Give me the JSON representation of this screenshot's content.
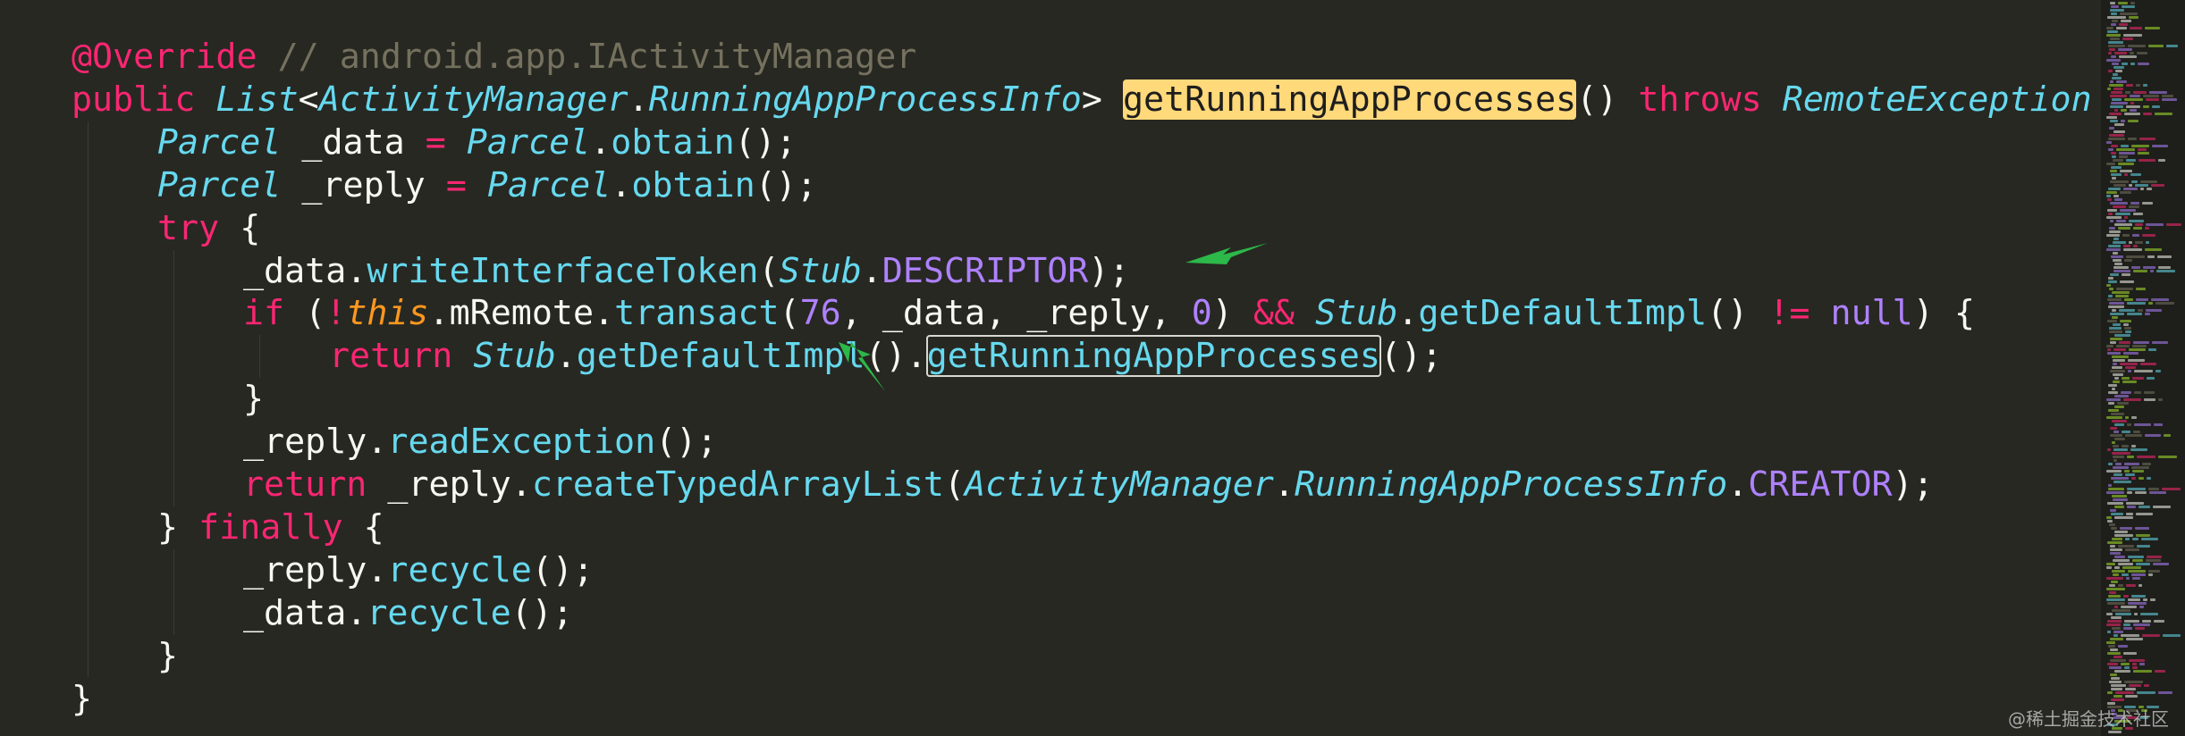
{
  "editor": {
    "lines": [
      {
        "indent": 0,
        "tokens": [
          {
            "t": "@Override",
            "c": "ann"
          },
          {
            "t": " // android.app.IActivityManager",
            "c": "comment"
          }
        ]
      },
      {
        "indent": 0,
        "tokens": [
          {
            "t": "public ",
            "c": "keyword"
          },
          {
            "t": "List",
            "c": "type"
          },
          {
            "t": "<",
            "c": "default"
          },
          {
            "t": "ActivityManager",
            "c": "type"
          },
          {
            "t": ".",
            "c": "default"
          },
          {
            "t": "RunningAppProcessInfo",
            "c": "type"
          },
          {
            "t": "> ",
            "c": "default"
          },
          {
            "t": "getRunningAppProcesses",
            "c": "hl"
          },
          {
            "t": "() ",
            "c": "default"
          },
          {
            "t": "throws ",
            "c": "keyword"
          },
          {
            "t": "RemoteException",
            "c": "type"
          }
        ]
      },
      {
        "indent": 1,
        "tokens": [
          {
            "t": "Parcel",
            "c": "type"
          },
          {
            "t": " _data ",
            "c": "default"
          },
          {
            "t": "=",
            "c": "keyword"
          },
          {
            "t": " ",
            "c": "default"
          },
          {
            "t": "Parcel",
            "c": "type"
          },
          {
            "t": ".",
            "c": "default"
          },
          {
            "t": "obtain",
            "c": "func"
          },
          {
            "t": "();",
            "c": "default"
          }
        ]
      },
      {
        "indent": 1,
        "tokens": [
          {
            "t": "Parcel",
            "c": "type"
          },
          {
            "t": " _reply ",
            "c": "default"
          },
          {
            "t": "=",
            "c": "keyword"
          },
          {
            "t": " ",
            "c": "default"
          },
          {
            "t": "Parcel",
            "c": "type"
          },
          {
            "t": ".",
            "c": "default"
          },
          {
            "t": "obtain",
            "c": "func"
          },
          {
            "t": "();",
            "c": "default"
          }
        ]
      },
      {
        "indent": 1,
        "tokens": [
          {
            "t": "try",
            "c": "keyword"
          },
          {
            "t": " {",
            "c": "default"
          }
        ]
      },
      {
        "indent": 2,
        "tokens": [
          {
            "t": "_data.",
            "c": "default"
          },
          {
            "t": "writeInterfaceToken",
            "c": "func"
          },
          {
            "t": "(",
            "c": "default"
          },
          {
            "t": "Stub",
            "c": "type"
          },
          {
            "t": ".",
            "c": "default"
          },
          {
            "t": "DESCRIPTOR",
            "c": "const"
          },
          {
            "t": ");",
            "c": "default"
          }
        ]
      },
      {
        "indent": 2,
        "tokens": [
          {
            "t": "if",
            "c": "keyword"
          },
          {
            "t": " (",
            "c": "default"
          },
          {
            "t": "!",
            "c": "keyword"
          },
          {
            "t": "this",
            "c": "this"
          },
          {
            "t": ".mRemote.",
            "c": "default"
          },
          {
            "t": "transact",
            "c": "func"
          },
          {
            "t": "(",
            "c": "default"
          },
          {
            "t": "76",
            "c": "const"
          },
          {
            "t": ", _data, _reply, ",
            "c": "default"
          },
          {
            "t": "0",
            "c": "const"
          },
          {
            "t": ") ",
            "c": "default"
          },
          {
            "t": "&&",
            "c": "keyword"
          },
          {
            "t": " ",
            "c": "default"
          },
          {
            "t": "Stub",
            "c": "type"
          },
          {
            "t": ".",
            "c": "default"
          },
          {
            "t": "getDefaultImpl",
            "c": "func"
          },
          {
            "t": "() ",
            "c": "default"
          },
          {
            "t": "!=",
            "c": "keyword"
          },
          {
            "t": " ",
            "c": "default"
          },
          {
            "t": "null",
            "c": "const"
          },
          {
            "t": ") {",
            "c": "default"
          }
        ]
      },
      {
        "indent": 3,
        "tokens": [
          {
            "t": "return",
            "c": "keyword"
          },
          {
            "t": " ",
            "c": "default"
          },
          {
            "t": "Stub",
            "c": "type"
          },
          {
            "t": ".",
            "c": "default"
          },
          {
            "t": "getDefaultImpl",
            "c": "func"
          },
          {
            "t": "().",
            "c": "default"
          },
          {
            "t": "getRunningAppProcesses",
            "c": "box"
          },
          {
            "t": "();",
            "c": "default"
          }
        ]
      },
      {
        "indent": 2,
        "tokens": [
          {
            "t": "}",
            "c": "default"
          }
        ]
      },
      {
        "indent": 2,
        "tokens": [
          {
            "t": "_reply.",
            "c": "default"
          },
          {
            "t": "readException",
            "c": "func"
          },
          {
            "t": "();",
            "c": "default"
          }
        ]
      },
      {
        "indent": 2,
        "tokens": [
          {
            "t": "return",
            "c": "keyword"
          },
          {
            "t": " _reply.",
            "c": "default"
          },
          {
            "t": "createTypedArrayList",
            "c": "func"
          },
          {
            "t": "(",
            "c": "default"
          },
          {
            "t": "ActivityManager",
            "c": "type"
          },
          {
            "t": ".",
            "c": "default"
          },
          {
            "t": "RunningAppProcessInfo",
            "c": "type"
          },
          {
            "t": ".",
            "c": "default"
          },
          {
            "t": "CREATOR",
            "c": "const"
          },
          {
            "t": ");",
            "c": "default"
          }
        ]
      },
      {
        "indent": 1,
        "tokens": [
          {
            "t": "} ",
            "c": "default"
          },
          {
            "t": "finally",
            "c": "keyword"
          },
          {
            "t": " {",
            "c": "default"
          }
        ]
      },
      {
        "indent": 2,
        "tokens": [
          {
            "t": "_reply.",
            "c": "default"
          },
          {
            "t": "recycle",
            "c": "func"
          },
          {
            "t": "();",
            "c": "default"
          }
        ]
      },
      {
        "indent": 2,
        "tokens": [
          {
            "t": "_data.",
            "c": "default"
          },
          {
            "t": "recycle",
            "c": "func"
          },
          {
            "t": "();",
            "c": "default"
          }
        ]
      },
      {
        "indent": 1,
        "tokens": [
          {
            "t": "}",
            "c": "default"
          }
        ]
      },
      {
        "indent": 0,
        "tokens": [
          {
            "t": "}",
            "c": "default"
          }
        ]
      }
    ]
  },
  "annotations": [
    {
      "name": "arrow-annotation-descriptor",
      "color": "#2DB84A"
    },
    {
      "name": "arrow-annotation-transact-code",
      "color": "#2DB84A"
    }
  ],
  "watermark": "@稀土掘金技术社区",
  "colors": {
    "background": "#272822",
    "minimap_background": "#1E1F1A",
    "keyword": "#F92672",
    "type": "#66D9EF",
    "constant": "#AE81FF",
    "this": "#FD971F",
    "comment": "#75715E",
    "highlight": "#FFD97A"
  }
}
